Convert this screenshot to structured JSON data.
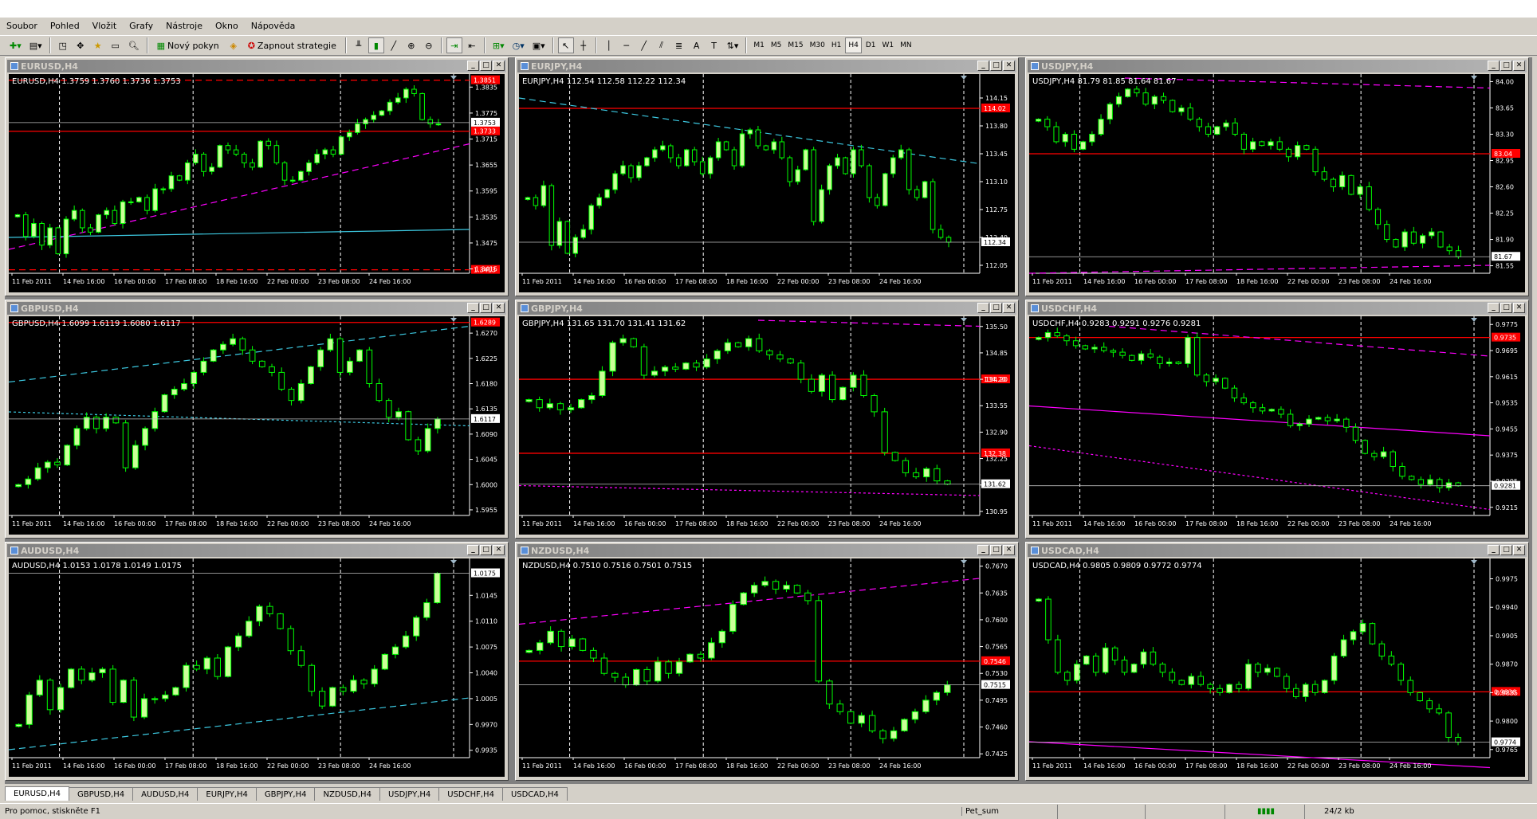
{
  "menu": [
    "Soubor",
    "Pohled",
    "Vložit",
    "Grafy",
    "Nástroje",
    "Okno",
    "Nápověda"
  ],
  "toolbar": {
    "new_order": "Nový pokyn",
    "strategies": "Zapnout strategie",
    "timeframes": [
      "M1",
      "M5",
      "M15",
      "M30",
      "H1",
      "H4",
      "D1",
      "W1",
      "MN"
    ],
    "active_tf": "H4"
  },
  "colors": {
    "bg": "#000000",
    "bull": "#ccff99",
    "bear": "#ffffff",
    "wick": "#00ff00",
    "red": "#ff0000",
    "magenta": "#ff00ff",
    "cyan": "#3cc8e0",
    "grid": "#c0c0c0"
  },
  "xlabels": [
    "11 Feb 2011",
    "14 Feb 16:00",
    "16 Feb 00:00",
    "17 Feb 08:00",
    "18 Feb 16:00",
    "22 Feb 00:00",
    "23 Feb 08:00",
    "24 Feb 16:00"
  ],
  "windows": [
    {
      "title": "EURUSD,H4",
      "info": "EURUSD,H4  1.3759 1.3760 1.3736 1.3753",
      "ticks": [
        "1.3835",
        "1.3775",
        "1.3715",
        "1.3655",
        "1.3595",
        "1.3535",
        "1.3475",
        "1.3415"
      ],
      "ymin": 1.3405,
      "ymax": 1.3865,
      "last": "1.3753",
      "lastv": 1.3753,
      "red_labels": [
        {
          "v": 1.3851,
          "t": "1.3851"
        },
        {
          "v": 1.3733,
          "t": "1.3733"
        },
        {
          "v": 1.3413,
          "t": "1.3413"
        }
      ],
      "closes": [
        1.354,
        1.349,
        1.352,
        1.347,
        1.351,
        1.345,
        1.353,
        1.355,
        1.351,
        1.35,
        1.354,
        1.355,
        1.352,
        1.357,
        1.357,
        1.358,
        1.355,
        1.36,
        1.36,
        1.363,
        1.362,
        1.366,
        1.368,
        1.364,
        1.365,
        1.37,
        1.369,
        1.368,
        1.366,
        1.365,
        1.371,
        1.37,
        1.366,
        1.362,
        1.362,
        1.364,
        1.366,
        1.368,
        1.369,
        1.368,
        1.372,
        1.373,
        1.375,
        1.376,
        1.377,
        1.378,
        1.38,
        1.381,
        1.383,
        1.382,
        1.376,
        1.375,
        1.375
      ]
    },
    {
      "title": "EURJPY,H4",
      "info": "EURJPY,H4  112.54 112.58 112.22 112.34",
      "ticks": [
        "114.15",
        "113.80",
        "113.45",
        "113.10",
        "112.75",
        "112.40",
        "112.05"
      ],
      "ymin": 111.95,
      "ymax": 114.45,
      "last": "112.34",
      "lastv": 112.34,
      "red_labels": [
        {
          "v": 114.02,
          "t": "114.02"
        }
      ],
      "closes": [
        112.9,
        112.8,
        113.05,
        112.3,
        112.6,
        112.2,
        112.4,
        112.5,
        112.8,
        112.9,
        113.0,
        113.2,
        113.3,
        113.15,
        113.3,
        113.4,
        113.5,
        113.55,
        113.4,
        113.3,
        113.5,
        113.35,
        113.2,
        113.4,
        113.6,
        113.5,
        113.3,
        113.7,
        113.75,
        113.55,
        113.5,
        113.6,
        113.4,
        113.1,
        113.25,
        113.5,
        112.6,
        113.0,
        113.3,
        113.4,
        113.2,
        113.5,
        113.3,
        112.9,
        112.8,
        113.2,
        113.4,
        113.5,
        113.0,
        112.9,
        113.1,
        112.5,
        112.4,
        112.34
      ],
      "extra_red": []
    },
    {
      "title": "USDJPY,H4",
      "info": "USDJPY,H4  81.79 81.85 81.64 81.67",
      "ticks": [
        "84.00",
        "83.65",
        "83.30",
        "82.95",
        "82.60",
        "82.25",
        "81.90",
        "81.55"
      ],
      "ymin": 81.45,
      "ymax": 84.1,
      "last": "81.67",
      "lastv": 81.67,
      "red_labels": [
        {
          "v": 83.04,
          "t": "83.04"
        }
      ],
      "closes": [
        83.5,
        83.4,
        83.2,
        83.3,
        83.1,
        83.2,
        83.3,
        83.5,
        83.7,
        83.8,
        83.9,
        83.85,
        83.7,
        83.8,
        83.75,
        83.6,
        83.65,
        83.5,
        83.4,
        83.3,
        83.4,
        83.45,
        83.3,
        83.1,
        83.2,
        83.15,
        83.2,
        83.1,
        83.0,
        83.15,
        83.1,
        82.8,
        82.7,
        82.6,
        82.75,
        82.5,
        82.6,
        82.3,
        82.1,
        81.9,
        81.8,
        82.0,
        81.85,
        81.95,
        82.0,
        81.8,
        81.75,
        81.67
      ]
    },
    {
      "title": "GBPUSD,H4",
      "info": "GBPUSD,H4  1.6099 1.6119 1.6080 1.6117",
      "ticks": [
        "1.6270",
        "1.6225",
        "1.6180",
        "1.6135",
        "1.6090",
        "1.6045",
        "1.6000",
        "1.5955"
      ],
      "ymin": 1.5945,
      "ymax": 1.63,
      "last": "1.6117",
      "lastv": 1.6117,
      "red_labels": [
        {
          "v": 1.6289,
          "t": "1.6289"
        }
      ],
      "closes": [
        1.6,
        1.601,
        1.603,
        1.604,
        1.6035,
        1.607,
        1.61,
        1.612,
        1.61,
        1.612,
        1.611,
        1.603,
        1.607,
        1.61,
        1.613,
        1.616,
        1.617,
        1.618,
        1.62,
        1.622,
        1.624,
        1.625,
        1.626,
        1.624,
        1.622,
        1.621,
        1.62,
        1.617,
        1.615,
        1.618,
        1.621,
        1.624,
        1.626,
        1.62,
        1.622,
        1.624,
        1.618,
        1.615,
        1.612,
        1.613,
        1.608,
        1.606,
        1.61,
        1.6117
      ]
    },
    {
      "title": "GBPJPY,H4",
      "info": "GBPJPY,H4  131.65 131.70 131.41 131.62",
      "ticks": [
        "135.50",
        "134.85",
        "134.20",
        "133.55",
        "132.90",
        "132.25",
        "131.60",
        "130.95"
      ],
      "ymin": 130.85,
      "ymax": 135.75,
      "last": "131.62",
      "lastv": 131.62,
      "red_labels": [
        {
          "v": 134.2,
          "t": "134.20"
        },
        {
          "v": 132.38,
          "t": "132.38"
        }
      ],
      "closes": [
        133.7,
        133.5,
        133.6,
        133.45,
        133.5,
        133.7,
        133.8,
        134.4,
        135.1,
        135.2,
        135.0,
        134.3,
        134.4,
        134.5,
        134.45,
        134.6,
        134.5,
        134.7,
        134.9,
        135.1,
        135.0,
        135.2,
        134.9,
        134.8,
        134.7,
        134.6,
        134.2,
        133.9,
        134.3,
        133.7,
        134.0,
        134.3,
        133.8,
        133.4,
        132.4,
        132.2,
        131.9,
        131.8,
        132.0,
        131.7,
        131.62
      ]
    },
    {
      "title": "USDCHF,H4",
      "info": "USDCHF,H4  0.9283 0.9291 0.9276 0.9281",
      "ticks": [
        "0.9775",
        "0.9695",
        "0.9615",
        "0.9535",
        "0.9455",
        "0.9375",
        "0.9295",
        "0.9215"
      ],
      "ymin": 0.919,
      "ymax": 0.98,
      "last": "0.9281",
      "lastv": 0.9281,
      "red_labels": [
        {
          "v": 0.9735,
          "t": "0.9735"
        }
      ],
      "closes": [
        0.9735,
        0.975,
        0.974,
        0.9725,
        0.971,
        0.97,
        0.9705,
        0.9695,
        0.969,
        0.968,
        0.9665,
        0.9685,
        0.9675,
        0.9655,
        0.966,
        0.9655,
        0.9735,
        0.962,
        0.96,
        0.961,
        0.958,
        0.955,
        0.9535,
        0.952,
        0.951,
        0.9515,
        0.95,
        0.9465,
        0.947,
        0.9485,
        0.949,
        0.948,
        0.9485,
        0.946,
        0.942,
        0.938,
        0.937,
        0.9385,
        0.934,
        0.931,
        0.93,
        0.9285,
        0.93,
        0.9275,
        0.929,
        0.9281
      ]
    },
    {
      "title": "AUDUSD,H4",
      "info": "AUDUSD,H4  1.0153 1.0178 1.0149 1.0175",
      "ticks": [
        "1.0145",
        "1.0110",
        "1.0075",
        "1.0040",
        "1.0005",
        "0.9970",
        "0.9935"
      ],
      "ymin": 0.9925,
      "ymax": 1.0195,
      "last": "1.0175",
      "lastv": 1.0175,
      "red_labels": [],
      "closes": [
        0.997,
        1.001,
        1.003,
        0.999,
        1.002,
        1.0045,
        1.003,
        1.004,
        1.0045,
        1.0,
        1.003,
        0.998,
        1.0005,
        1.0005,
        1.001,
        1.002,
        1.005,
        1.0045,
        1.006,
        1.0035,
        1.0075,
        1.009,
        1.011,
        1.013,
        1.012,
        1.01,
        1.007,
        1.005,
        1.0015,
        0.9995,
        1.002,
        1.0015,
        1.003,
        1.0025,
        1.0045,
        1.0065,
        1.0075,
        1.009,
        1.0115,
        1.0135,
        1.0175
      ]
    },
    {
      "title": "NZDUSD,H4",
      "info": "NZDUSD,H4  0.7510 0.7516 0.7501 0.7515",
      "ticks": [
        "0.7670",
        "0.7635",
        "0.7600",
        "0.7565",
        "0.7530",
        "0.7495",
        "0.7460",
        "0.7425"
      ],
      "ymin": 0.742,
      "ymax": 0.768,
      "last": "0.7515",
      "lastv": 0.7515,
      "red_labels": [
        {
          "v": 0.7546,
          "t": "0.7546"
        }
      ],
      "closes": [
        0.756,
        0.757,
        0.7585,
        0.7565,
        0.7575,
        0.756,
        0.755,
        0.753,
        0.7525,
        0.7515,
        0.7535,
        0.752,
        0.7545,
        0.753,
        0.7545,
        0.7555,
        0.755,
        0.757,
        0.7585,
        0.762,
        0.7635,
        0.7645,
        0.765,
        0.764,
        0.7645,
        0.7635,
        0.7625,
        0.752,
        0.749,
        0.748,
        0.7465,
        0.7475,
        0.7455,
        0.7445,
        0.7455,
        0.747,
        0.748,
        0.7495,
        0.7505,
        0.7515
      ]
    },
    {
      "title": "USDCAD,H4",
      "info": "USDCAD,H4  0.9805 0.9809 0.9772 0.9774",
      "ticks": [
        "0.9975",
        "0.9940",
        "0.9905",
        "0.9870",
        "0.9835",
        "0.9800",
        "0.9765"
      ],
      "ymin": 0.9755,
      "ymax": 1.0,
      "last": "0.9774",
      "lastv": 0.9774,
      "red_labels": [
        {
          "v": 0.9836,
          "t": "0.9836"
        }
      ],
      "closes": [
        0.995,
        0.99,
        0.986,
        0.985,
        0.987,
        0.988,
        0.986,
        0.989,
        0.9875,
        0.986,
        0.987,
        0.9885,
        0.987,
        0.986,
        0.985,
        0.9845,
        0.9855,
        0.9845,
        0.984,
        0.9835,
        0.9845,
        0.984,
        0.987,
        0.986,
        0.9865,
        0.9855,
        0.984,
        0.983,
        0.9845,
        0.9835,
        0.985,
        0.988,
        0.99,
        0.991,
        0.992,
        0.9895,
        0.988,
        0.987,
        0.985,
        0.9835,
        0.9825,
        0.9815,
        0.981,
        0.978,
        0.9774
      ]
    }
  ],
  "tabs": [
    "EURUSD,H4",
    "GBPUSD,H4",
    "AUDUSD,H4",
    "EURJPY,H4",
    "GBPJPY,H4",
    "NZDUSD,H4",
    "USDJPY,H4",
    "USDCHF,H4",
    "USDCAD,H4"
  ],
  "active_tab": "EURUSD,H4",
  "status": {
    "help": "Pro pomoc, stiskněte F1",
    "profile": "Pet_sum",
    "traffic": "24/2 kb"
  }
}
